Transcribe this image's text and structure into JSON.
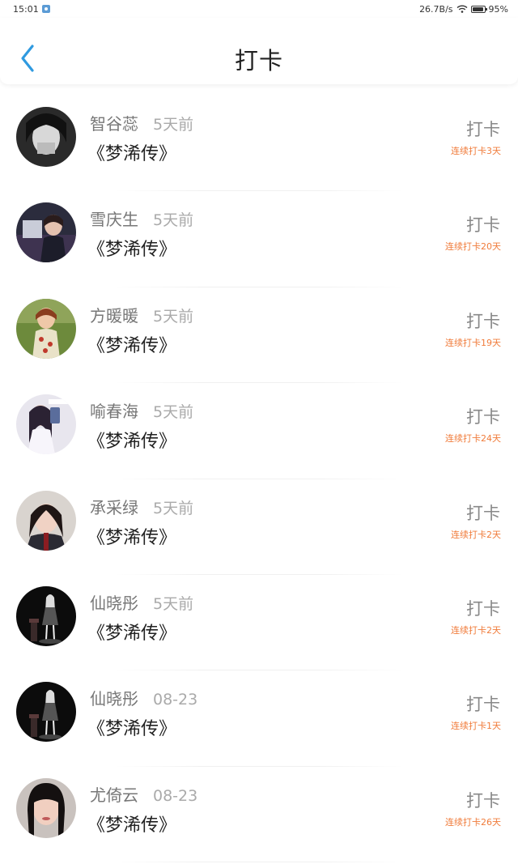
{
  "status_bar": {
    "time": "15:01",
    "net_speed": "26.7B/s",
    "battery": "95%"
  },
  "header": {
    "title": "打卡"
  },
  "icons": {
    "back": "chevron-left-icon",
    "wifi": "wifi-icon",
    "battery": "battery-icon"
  },
  "colors": {
    "accent": "#2f9ae0",
    "streak": "#f07b3a",
    "title": "#222222",
    "muted": "#888888"
  },
  "items": [
    {
      "username": "智谷蕊",
      "time": "5天前",
      "book": "《梦浠传》",
      "action": "打卡",
      "streak": "连续打卡3天"
    },
    {
      "username": "雪庆生",
      "time": "5天前",
      "book": "《梦浠传》",
      "action": "打卡",
      "streak": "连续打卡20天"
    },
    {
      "username": "方暖暖",
      "time": "5天前",
      "book": "《梦浠传》",
      "action": "打卡",
      "streak": "连续打卡19天"
    },
    {
      "username": "喻春海",
      "time": "5天前",
      "book": "《梦浠传》",
      "action": "打卡",
      "streak": "连续打卡24天"
    },
    {
      "username": "承采绿",
      "time": "5天前",
      "book": "《梦浠传》",
      "action": "打卡",
      "streak": "连续打卡2天"
    },
    {
      "username": "仙晓彤",
      "time": "5天前",
      "book": "《梦浠传》",
      "action": "打卡",
      "streak": "连续打卡2天"
    },
    {
      "username": "仙晓彤",
      "time": "08-23",
      "book": "《梦浠传》",
      "action": "打卡",
      "streak": "连续打卡1天"
    },
    {
      "username": "尤倚云",
      "time": "08-23",
      "book": "《梦浠传》",
      "action": "打卡",
      "streak": "连续打卡26天"
    }
  ]
}
